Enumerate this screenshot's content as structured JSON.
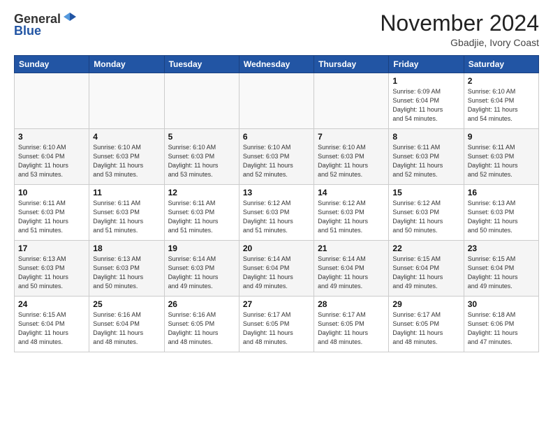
{
  "logo": {
    "general": "General",
    "blue": "Blue"
  },
  "title": "November 2024",
  "subtitle": "Gbadjie, Ivory Coast",
  "days_header": [
    "Sunday",
    "Monday",
    "Tuesday",
    "Wednesday",
    "Thursday",
    "Friday",
    "Saturday"
  ],
  "weeks": [
    [
      {
        "num": "",
        "info": ""
      },
      {
        "num": "",
        "info": ""
      },
      {
        "num": "",
        "info": ""
      },
      {
        "num": "",
        "info": ""
      },
      {
        "num": "",
        "info": ""
      },
      {
        "num": "1",
        "info": "Sunrise: 6:09 AM\nSunset: 6:04 PM\nDaylight: 11 hours\nand 54 minutes."
      },
      {
        "num": "2",
        "info": "Sunrise: 6:10 AM\nSunset: 6:04 PM\nDaylight: 11 hours\nand 54 minutes."
      }
    ],
    [
      {
        "num": "3",
        "info": "Sunrise: 6:10 AM\nSunset: 6:04 PM\nDaylight: 11 hours\nand 53 minutes."
      },
      {
        "num": "4",
        "info": "Sunrise: 6:10 AM\nSunset: 6:03 PM\nDaylight: 11 hours\nand 53 minutes."
      },
      {
        "num": "5",
        "info": "Sunrise: 6:10 AM\nSunset: 6:03 PM\nDaylight: 11 hours\nand 53 minutes."
      },
      {
        "num": "6",
        "info": "Sunrise: 6:10 AM\nSunset: 6:03 PM\nDaylight: 11 hours\nand 52 minutes."
      },
      {
        "num": "7",
        "info": "Sunrise: 6:10 AM\nSunset: 6:03 PM\nDaylight: 11 hours\nand 52 minutes."
      },
      {
        "num": "8",
        "info": "Sunrise: 6:11 AM\nSunset: 6:03 PM\nDaylight: 11 hours\nand 52 minutes."
      },
      {
        "num": "9",
        "info": "Sunrise: 6:11 AM\nSunset: 6:03 PM\nDaylight: 11 hours\nand 52 minutes."
      }
    ],
    [
      {
        "num": "10",
        "info": "Sunrise: 6:11 AM\nSunset: 6:03 PM\nDaylight: 11 hours\nand 51 minutes."
      },
      {
        "num": "11",
        "info": "Sunrise: 6:11 AM\nSunset: 6:03 PM\nDaylight: 11 hours\nand 51 minutes."
      },
      {
        "num": "12",
        "info": "Sunrise: 6:11 AM\nSunset: 6:03 PM\nDaylight: 11 hours\nand 51 minutes."
      },
      {
        "num": "13",
        "info": "Sunrise: 6:12 AM\nSunset: 6:03 PM\nDaylight: 11 hours\nand 51 minutes."
      },
      {
        "num": "14",
        "info": "Sunrise: 6:12 AM\nSunset: 6:03 PM\nDaylight: 11 hours\nand 51 minutes."
      },
      {
        "num": "15",
        "info": "Sunrise: 6:12 AM\nSunset: 6:03 PM\nDaylight: 11 hours\nand 50 minutes."
      },
      {
        "num": "16",
        "info": "Sunrise: 6:13 AM\nSunset: 6:03 PM\nDaylight: 11 hours\nand 50 minutes."
      }
    ],
    [
      {
        "num": "17",
        "info": "Sunrise: 6:13 AM\nSunset: 6:03 PM\nDaylight: 11 hours\nand 50 minutes."
      },
      {
        "num": "18",
        "info": "Sunrise: 6:13 AM\nSunset: 6:03 PM\nDaylight: 11 hours\nand 50 minutes."
      },
      {
        "num": "19",
        "info": "Sunrise: 6:14 AM\nSunset: 6:03 PM\nDaylight: 11 hours\nand 49 minutes."
      },
      {
        "num": "20",
        "info": "Sunrise: 6:14 AM\nSunset: 6:04 PM\nDaylight: 11 hours\nand 49 minutes."
      },
      {
        "num": "21",
        "info": "Sunrise: 6:14 AM\nSunset: 6:04 PM\nDaylight: 11 hours\nand 49 minutes."
      },
      {
        "num": "22",
        "info": "Sunrise: 6:15 AM\nSunset: 6:04 PM\nDaylight: 11 hours\nand 49 minutes."
      },
      {
        "num": "23",
        "info": "Sunrise: 6:15 AM\nSunset: 6:04 PM\nDaylight: 11 hours\nand 49 minutes."
      }
    ],
    [
      {
        "num": "24",
        "info": "Sunrise: 6:15 AM\nSunset: 6:04 PM\nDaylight: 11 hours\nand 48 minutes."
      },
      {
        "num": "25",
        "info": "Sunrise: 6:16 AM\nSunset: 6:04 PM\nDaylight: 11 hours\nand 48 minutes."
      },
      {
        "num": "26",
        "info": "Sunrise: 6:16 AM\nSunset: 6:05 PM\nDaylight: 11 hours\nand 48 minutes."
      },
      {
        "num": "27",
        "info": "Sunrise: 6:17 AM\nSunset: 6:05 PM\nDaylight: 11 hours\nand 48 minutes."
      },
      {
        "num": "28",
        "info": "Sunrise: 6:17 AM\nSunset: 6:05 PM\nDaylight: 11 hours\nand 48 minutes."
      },
      {
        "num": "29",
        "info": "Sunrise: 6:17 AM\nSunset: 6:05 PM\nDaylight: 11 hours\nand 48 minutes."
      },
      {
        "num": "30",
        "info": "Sunrise: 6:18 AM\nSunset: 6:06 PM\nDaylight: 11 hours\nand 47 minutes."
      }
    ]
  ]
}
